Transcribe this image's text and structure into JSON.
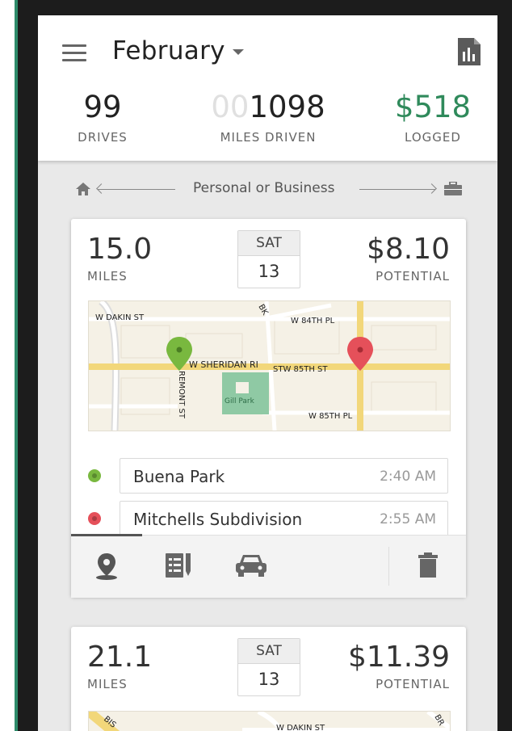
{
  "header": {
    "month": "February",
    "stats": {
      "drives_value": "99",
      "drives_label": "DRIVES",
      "miles_prefix": "00",
      "miles_value": "1098",
      "miles_label": "MILES DRIVEN",
      "logged_value": "$518",
      "logged_label": "LOGGED"
    }
  },
  "classify": {
    "label": "Personal or Business"
  },
  "drives": [
    {
      "miles": "15.0",
      "miles_label": "MILES",
      "day_of_week": "SAT",
      "day": "13",
      "potential": "$8.10",
      "potential_label": "POTENTIAL",
      "map_labels": {
        "w_dakin": "W DAKIN ST",
        "w_84th": "W 84TH PL",
        "w_sheridan": "W SHERIDAN RI",
        "w_85th_st": "STW 85TH ST",
        "fremont": "REMONT ST",
        "gill_park": "Gill Park",
        "w_85th_pl": "W 85TH PL",
        "bk": "BK"
      },
      "start": {
        "name": "Buena Park",
        "time": "2:40 AM"
      },
      "end": {
        "name": "Mitchells Subdivision",
        "time": "2:55 AM"
      }
    },
    {
      "miles": "21.1",
      "miles_label": "MILES",
      "day_of_week": "SAT",
      "day": "13",
      "potential": "$11.39",
      "potential_label": "POTENTIAL",
      "map_labels": {
        "w_dakin": "W DAKIN ST",
        "bis": "BIS",
        "br": "BR"
      }
    }
  ],
  "colors": {
    "accent_green": "#2f8a5b",
    "start_dot": "#79b83f",
    "end_dot": "#e5505a",
    "map_road": "#f2d77a"
  },
  "icons": [
    "menu-icon",
    "report-icon",
    "home-icon",
    "briefcase-icon",
    "location-pin-icon",
    "notes-icon",
    "car-icon",
    "trash-icon"
  ]
}
